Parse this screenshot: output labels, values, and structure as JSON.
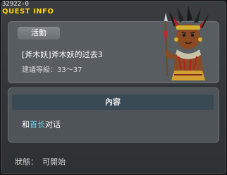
{
  "window": {
    "quest_id": "32922-0",
    "title": "QUEST INFO"
  },
  "quest": {
    "tag": "活動",
    "name": "[斧木妖]斧木妖的过去3",
    "level_label": "建議等級：33～37"
  },
  "content": {
    "header": "內容",
    "line_prefix": "和",
    "line_highlight": "首长",
    "line_suffix": "对话"
  },
  "status": {
    "label": "狀態：",
    "value": "可開始"
  },
  "colors": {
    "title": "#ffd200",
    "highlight": "#5fd8f0"
  },
  "icons": {
    "npc": "tribal-chief-portrait"
  }
}
